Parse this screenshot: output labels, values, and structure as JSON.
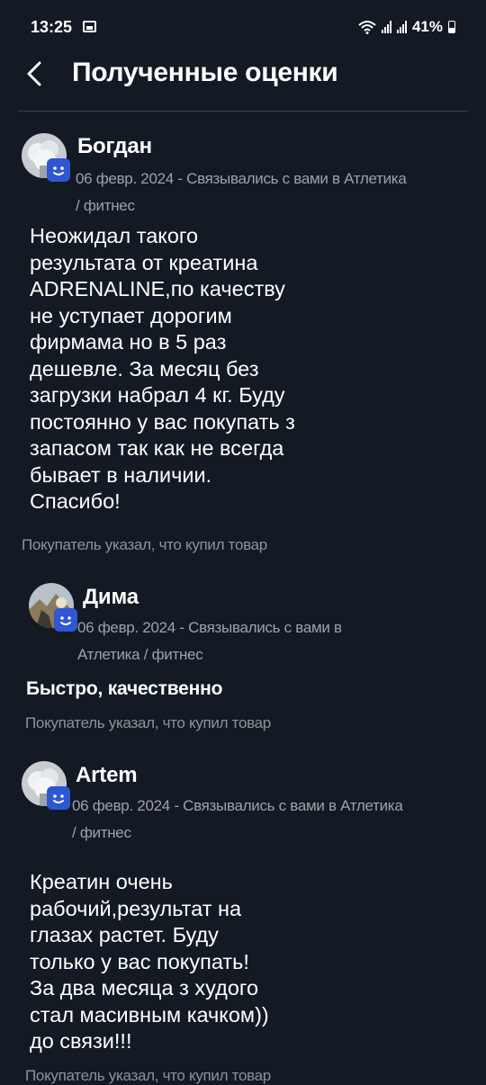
{
  "status_bar": {
    "time": "13:25",
    "battery": "41%"
  },
  "header": {
    "title": "Полученные оценки"
  },
  "reviews": [
    {
      "name": "Богдан",
      "meta": "06 февр. 2024 - Связывались с вами в Атлетика / фитнес",
      "text": "Неожидал такого\nрезультата от креатина\nADRENALINE,по качеству\nне уступает дорогим\nфирмама но в 5 раз\nдешевле. За месяц без\nзагрузки набрал 4 кг. Буду\nпостоянно у вас покупать з\nзапасом так как не всегда\nбывает в наличии.\nСпасибо!",
      "note": "Покупатель указал, что купил товар"
    },
    {
      "name": "Дима",
      "meta": "06 февр. 2024 - Связывались с вами в Атлетика / фитнес",
      "text": "Быстро, качественно",
      "note": "Покупатель указал, что купил товар"
    },
    {
      "name": "Artem",
      "meta": "06 февр. 2024 - Связывались с вами в Атлетика / фитнес",
      "text": "Креатин очень\nрабочий,результат на\nглазах растет. Буду\nтолько у вас покупать!\nЗа два месяца з худого\nстал масивным качком))\nдо связи!!!",
      "note": "Покупатель указал, что купил товар"
    }
  ],
  "icons": {
    "back": "chevron-left-icon",
    "badge": "smiley-badge-icon"
  },
  "colors": {
    "background": "#141a24",
    "badge": "#2f57d4",
    "muted_text": "#9da1a9"
  }
}
